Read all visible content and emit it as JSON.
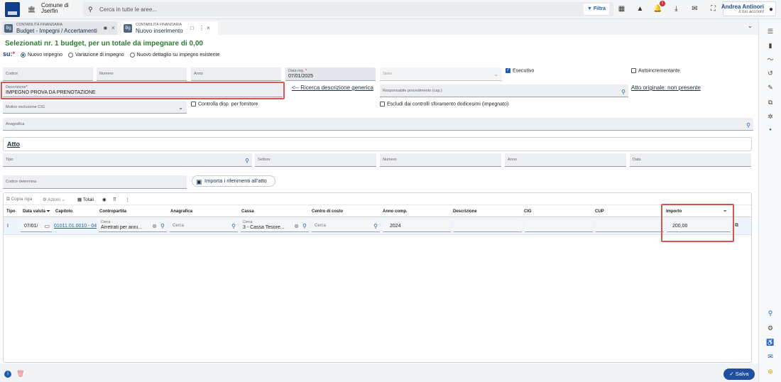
{
  "header": {
    "comune_line1": "Comune di",
    "comune_line2": "Jserfin",
    "search_placeholder": "Cerca in tutte le aree...",
    "filtra": "Filtra",
    "notif_count": "1",
    "user_name": "Andrea Antinori",
    "user_sub": "Il tuo account"
  },
  "tabs": [
    {
      "module": "CONTABILITÀ FINANZIARIA",
      "label": "Budget - Impegni / Accertamenti",
      "icon": "Bg"
    },
    {
      "module": "CONTABILITÀ FINANZIARIA",
      "label": "Nuovo inserimento",
      "icon": "Bg"
    }
  ],
  "page": {
    "title": "Selezionati nr. 1 budget, per un totale da impegnare di 0,00",
    "su_label": "su:",
    "su_required": "*",
    "radio_options": [
      "Nuovo impegno",
      "Variazione di impegno",
      "Nuovo dettaglio su impegno esistente"
    ]
  },
  "form": {
    "codice": "Codice",
    "numero": "Numero",
    "anno": "Anno",
    "data_reg_label": "Data reg.",
    "data_reg_value": "07/01/2025",
    "stato": "Stato",
    "esecutivo": "Esecutivo",
    "autoincrementante": "Autoincrementante",
    "descrizione_label": "Descrizione",
    "descrizione_value": "IMPEGNO PROVA DA PRENOTAZIONE",
    "ricerca_link": "<-- Ricerca descrizione generica",
    "responsabile": "Responsabile procedimento (cap.)",
    "atto_originale": "Atto originale: non presente",
    "motivo_cig": "Motivo esclusione CIG",
    "controlla_disp": "Controlla disp. per fornitore",
    "escludi": "Escludi dai controlli sforamento dodicesimi (impegnato)",
    "anagrafica": "Anagrafica",
    "required": "*"
  },
  "atto": {
    "title": "Atto",
    "tipo": "Tipo",
    "settore": "Settore",
    "numero": "Numero",
    "anno": "Anno",
    "data": "Data",
    "codice_determina": "Codice determina",
    "importa_btn": "Importa i riferimenti all'atto"
  },
  "grid": {
    "toolbar": {
      "copia": "Copia riga",
      "azioni": "Azioni",
      "totali": "Totali"
    },
    "columns": [
      "Tipo",
      "Data valuta",
      "Capitolo",
      "Contropartita",
      "Anagrafica",
      "Cassa",
      "Centro di costo",
      "Anno comp.",
      "Descrizione",
      "CIG",
      "CUP",
      "Importo"
    ],
    "row": {
      "tipo": "I",
      "data_valuta": "07/01/",
      "capitolo": "01011.01.0010 - 04",
      "contropartita_ph": "Cerca",
      "contropartita_val": "Arretrati per anni...",
      "anagrafica_ph": "Cerca",
      "cassa_ph": "Cerca",
      "cassa_val": "3 - Cassa Tesore...",
      "centro_ph": "Cerca",
      "anno_comp": "2024",
      "importo": "200,00"
    }
  },
  "footer": {
    "salva": "Salva"
  }
}
